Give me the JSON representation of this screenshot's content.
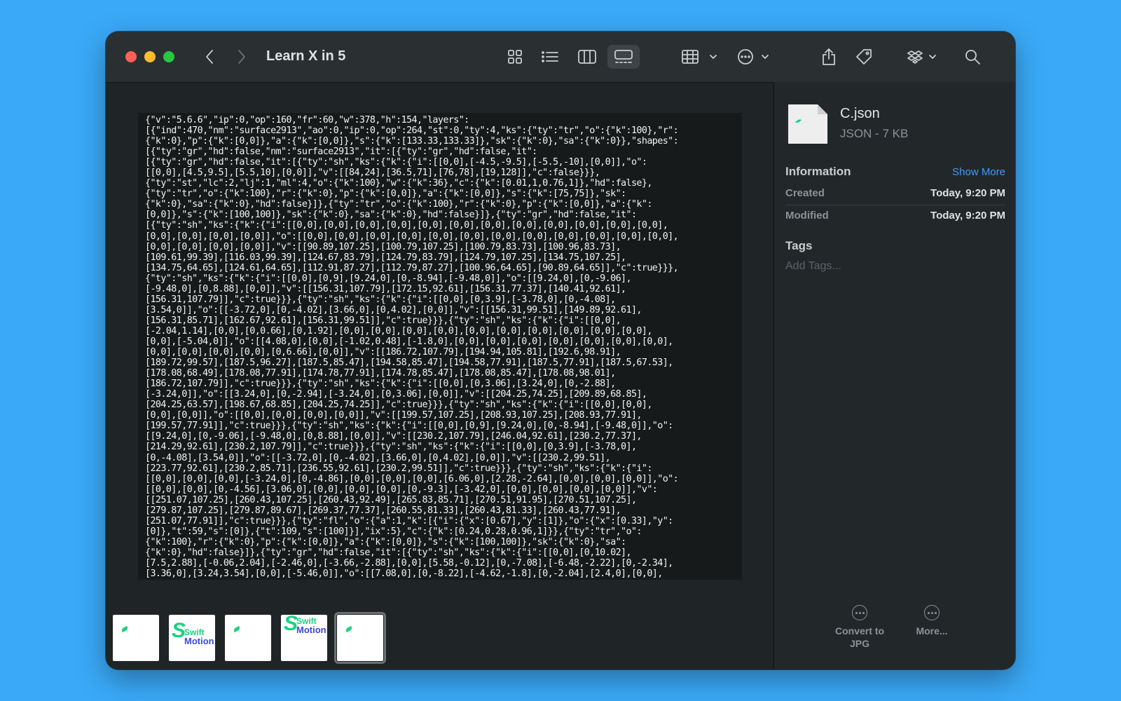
{
  "window": {
    "title": "Learn X in 5"
  },
  "preview": {
    "content": "{\"v\":\"5.6.6\",\"ip\":0,\"op\":160,\"fr\":60,\"w\":378,\"h\":154,\"layers\":\n[{\"ind\":470,\"nm\":\"surface2913\",\"ao\":0,\"ip\":0,\"op\":264,\"st\":0,\"ty\":4,\"ks\":{\"ty\":\"tr\",\"o\":{\"k\":100},\"r\":\n{\"k\":0},\"p\":{\"k\":[0,0]},\"a\":{\"k\":[0,0]},\"s\":{\"k\":[133.33,133.33]},\"sk\":{\"k\":0},\"sa\":{\"k\":0}},\"shapes\":\n[{\"ty\":\"gr\",\"hd\":false,\"nm\":\"surface2913\",\"it\":[{\"ty\":\"gr\",\"hd\":false,\"it\":\n[{\"ty\":\"gr\",\"hd\":false,\"it\":[{\"ty\":\"sh\",\"ks\":{\"k\":{\"i\":[[0,0],[-4.5,-9.5],[-5.5,-10],[0,0]],\"o\":\n[[0,0],[4.5,9.5],[5.5,10],[0,0]],\"v\":[[84,24],[36.5,71],[76,78],[19,128]],\"c\":false}}},\n{\"ty\":\"st\",\"lc\":2,\"lj\":1,\"ml\":4,\"o\":{\"k\":100},\"w\":{\"k\":36},\"c\":{\"k\":[0.01,1,0.76,1]},\"hd\":false},\n{\"ty\":\"tr\",\"o\":{\"k\":100},\"r\":{\"k\":0},\"p\":{\"k\":[0,0]},\"a\":{\"k\":[0,0]},\"s\":{\"k\":[75,75]},\"sk\":\n{\"k\":0},\"sa\":{\"k\":0},\"hd\":false}]},{\"ty\":\"tr\",\"o\":{\"k\":100},\"r\":{\"k\":0},\"p\":{\"k\":[0,0]},\"a\":{\"k\":\n[0,0]},\"s\":{\"k\":[100,100]},\"sk\":{\"k\":0},\"sa\":{\"k\":0},\"hd\":false}]},{\"ty\":\"gr\",\"hd\":false,\"it\":\n[{\"ty\":\"sh\",\"ks\":{\"k\":{\"i\":[[0,0],[0,0],[0,0],[0,0],[0,0],[0,0],[0,0],[0,0],[0,0],[0,0],[0,0],[0,0],\n[0,0],[0,0],[0,0],[0,0]],\"o\":[[0,0],[0,0],[0,0],[0,0],[0,0],[0,0],[0,0],[0,0],[0,0],[0,0],[0,0],[0,0],\n[0,0],[0,0],[0,0],[0,0]],\"v\":[[90.89,107.25],[100.79,107.25],[100.79,83.73],[100.96,83.73],\n[109.61,99.39],[116.03,99.39],[124.67,83.79],[124.79,83.79],[124.79,107.25],[134.75,107.25],\n[134.75,64.65],[124.61,64.65],[112.91,87.27],[112.79,87.27],[100.96,64.65],[90.89,64.65]],\"c\":true}}},\n{\"ty\":\"sh\",\"ks\":{\"k\":{\"i\":[[0,0],[0,9],[9.24,0],[0,-8.94],[-9.48,0]],\"o\":[[9.24,0],[0,-9.06],\n[-9.48,0],[0,8.88],[0,0]],\"v\":[[156.31,107.79],[172.15,92.61],[156.31,77.37],[140.41,92.61],\n[156.31,107.79]],\"c\":true}}},{\"ty\":\"sh\",\"ks\":{\"k\":{\"i\":[[0,0],[0,3.9],[-3.78,0],[0,-4.08],\n[3.54,0]],\"o\":[[-3.72,0],[0,-4.02],[3.66,0],[0,4.02],[0,0]],\"v\":[[156.31,99.51],[149.89,92.61],\n[156.31,85.71],[162.67,92.61],[156.31,99.51]],\"c\":true}}},{\"ty\":\"sh\",\"ks\":{\"k\":{\"i\":[[0,0],\n[-2.04,1.14],[0,0],[0,0.66],[0,1.92],[0,0],[0,0],[0,0],[0,0],[0,0],[0,0],[0,0],[0,0],[0,0],[0,0],\n[0,0],[-5.04,0]],\"o\":[[4.08,0],[0,0],[-1.02,0.48],[-1.8,0],[0,0],[0,0],[0,0],[0,0],[0,0],[0,0],[0,0],\n[0,0],[0,0],[0,0],[0,0],[0,6.66],[0,0]],\"v\":[[186.72,107.79],[194.94,105.81],[192.6,98.91],\n[189.72,99.57],[187.5,96.27],[187.5,85.47],[194.58,85.47],[194.58,77.91],[187.5,77.91],[187.5,67.53],\n[178.08,68.49],[178.08,77.91],[174.78,77.91],[174.78,85.47],[178.08,85.47],[178.08,98.01],\n[186.72,107.79]],\"c\":true}}},{\"ty\":\"sh\",\"ks\":{\"k\":{\"i\":[[0,0],[0,3.06],[3.24,0],[0,-2.88],\n[-3.24,0]],\"o\":[[3.24,0],[0,-2.94],[-3.24,0],[0,3.06],[0,0]],\"v\":[[204.25,74.25],[209.89,68.85],\n[204.25,63.57],[198.67,68.85],[204.25,74.25]],\"c\":true}}},{\"ty\":\"sh\",\"ks\":{\"k\":{\"i\":[[0,0],[0,0],\n[0,0],[0,0]],\"o\":[[0,0],[0,0],[0,0],[0,0]],\"v\":[[199.57,107.25],[208.93,107.25],[208.93,77.91],\n[199.57,77.91]],\"c\":true}}},{\"ty\":\"sh\",\"ks\":{\"k\":{\"i\":[[0,0],[0,9],[9.24,0],[0,-8.94],[-9.48,0]],\"o\":\n[[9.24,0],[0,-9.06],[-9.48,0],[0,8.88],[0,0]],\"v\":[[230.2,107.79],[246.04,92.61],[230.2,77.37],\n[214.29,92.61],[230.2,107.79]],\"c\":true}}},{\"ty\":\"sh\",\"ks\":{\"k\":{\"i\":[[0,0],[0,3.9],[-3.78,0],\n[0,-4.08],[3.54,0]],\"o\":[[-3.72,0],[0,-4.02],[3.66,0],[0,4.02],[0,0]],\"v\":[[230.2,99.51],\n[223.77,92.61],[230.2,85.71],[236.55,92.61],[230.2,99.51]],\"c\":true}}},{\"ty\":\"sh\",\"ks\":{\"k\":{\"i\":\n[[0,0],[0,0],[0,0],[-3.24,0],[0,-4.86],[0,0],[0,0],[0,0],[6.06,0],[2.28,-2.64],[0,0],[0,0],[0,0]],\"o\":\n[[0,0],[0,0],[0,-4.56],[3.06,0],[0,0],[0,0],[0,0],[0,-9.3],[-3.42,0],[0,0],[0,0],[0,0],[0,0]],\"v\":\n[[251.07,107.25],[260.43,107.25],[260.43,92.49],[265.83,85.71],[270.51,91.95],[270.51,107.25],\n[279.87,107.25],[279.87,89.67],[269.37,77.37],[260.55,81.33],[260.43,81.33],[260.43,77.91],\n[251.07,77.91]],\"c\":true}}},{\"ty\":\"fl\",\"o\":{\"a\":1,\"k\":[{\"i\":{\"x\":[0.67],\"y\":[1]},\"o\":{\"x\":[0.33],\"y\":\n[0]},\"t\":59,\"s\":[0]},{\"t\":109,\"s\":[100]}],\"ix\":5},\"c\":{\"k\":[0.24,0.28,0.96,1]}},{\"ty\":\"tr\",\"o\":\n{\"k\":100},\"r\":{\"k\":0},\"p\":{\"k\":[0,0]},\"a\":{\"k\":[0,0]},\"s\":{\"k\":[100,100]},\"sk\":{\"k\":0},\"sa\":\n{\"k\":0},\"hd\":false}]},{\"ty\":\"gr\",\"hd\":false,\"it\":[{\"ty\":\"sh\",\"ks\":{\"k\":{\"i\":[[0,0],[0,10.02],\n[7.5,2.88],[-0.06,2.04],[-2.46,0],[-3.66,-2.88],[0,0],[5.58,-0.12],[0,-7.08],[-6.48,-2.22],[0,-2.34],\n[3.36,0],[3.24,3.54],[0,0],[-5.46,0]],\"o\":[[7.08,0],[0,-8.22],[-4.62,-1.8],[0,-2.04],[2.4,0],[0,0],"
  },
  "thumbnails": [
    {
      "kind": "blank"
    },
    {
      "kind": "logo",
      "line1": "Swift",
      "line2": "Motion"
    },
    {
      "kind": "blank"
    },
    {
      "kind": "logo",
      "line1": "Swift",
      "line2": "Motion"
    },
    {
      "kind": "blank"
    }
  ],
  "sidebar": {
    "file_name": "C.json",
    "file_subtitle": "JSON - 7 KB",
    "info_heading": "Information",
    "show_more": "Show More",
    "created_label": "Created",
    "created_value": "Today, 9:20 PM",
    "modified_label": "Modified",
    "modified_value": "Today, 9:20 PM",
    "tags_heading": "Tags",
    "tags_placeholder": "Add Tags...",
    "actions": [
      {
        "label": "Convert to JPG"
      },
      {
        "label": "More..."
      }
    ]
  },
  "colors": {
    "desktop": "#3aa9f7",
    "accent_link": "#3d9bff",
    "logo_green": "#16d47f",
    "logo_blue": "#3a49d8"
  }
}
